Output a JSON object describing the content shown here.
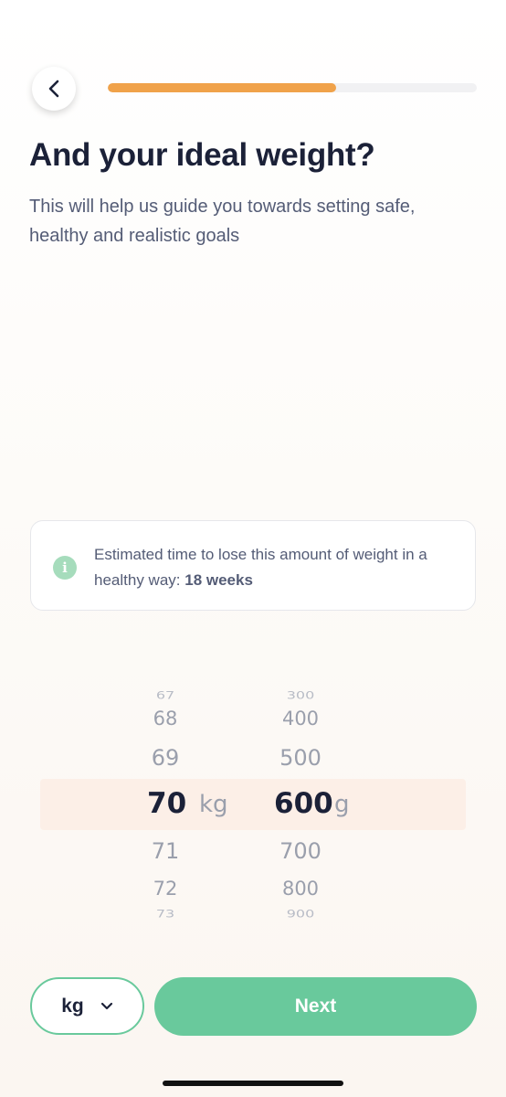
{
  "header": {
    "back_icon": "chevron-left-icon",
    "progress_percent": 62,
    "progress_color": "#f0a24a"
  },
  "title": "And your ideal weight?",
  "subtitle": "This will help us guide you towards setting safe, healthy and realistic goals",
  "info": {
    "icon": "info-icon",
    "text_prefix": "Estimated time to lose this amount of weight in a healthy way: ",
    "text_bold": "18 weeks"
  },
  "picker": {
    "kg_values": [
      "67",
      "68",
      "69",
      "71",
      "72",
      "73"
    ],
    "kg_selected": "70",
    "kg_unit": "kg",
    "g_values": [
      "300",
      "400",
      "500",
      "700",
      "800",
      "900"
    ],
    "g_selected": "600",
    "g_unit": "g"
  },
  "footer": {
    "unit_select": "kg",
    "dropdown_icon": "chevron-down-icon",
    "next_label": "Next",
    "accent_color": "#69c99c"
  }
}
